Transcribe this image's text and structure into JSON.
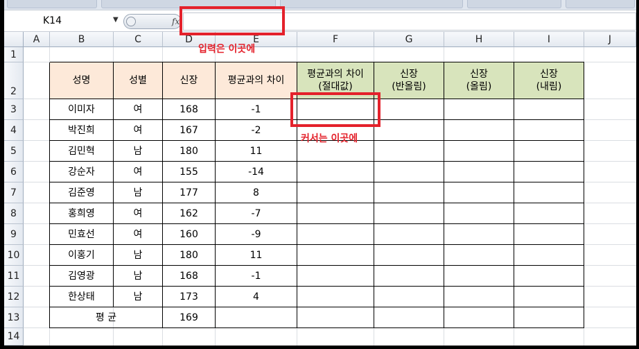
{
  "formula_bar": {
    "name_box": "K14",
    "fx_label": "fx",
    "formula_value": ""
  },
  "columns": [
    "A",
    "B",
    "C",
    "D",
    "E",
    "F",
    "G",
    "H",
    "I",
    "J"
  ],
  "rows": [
    "1",
    "2",
    "3",
    "4",
    "5",
    "6",
    "7",
    "8",
    "9",
    "10",
    "11",
    "12",
    "13",
    "14"
  ],
  "table": {
    "headers": [
      "성명",
      "성별",
      "신장",
      "평균과의 차이",
      "평균과의 차이\n(절대값)",
      "신장\n(반올림)",
      "신장\n(올림)",
      "신장\n(내림)"
    ],
    "rows": [
      [
        "이미자",
        "여",
        "168",
        "-1",
        "",
        "",
        "",
        ""
      ],
      [
        "박진희",
        "여",
        "167",
        "-2",
        "",
        "",
        "",
        ""
      ],
      [
        "김민혁",
        "남",
        "180",
        "11",
        "",
        "",
        "",
        ""
      ],
      [
        "강순자",
        "여",
        "155",
        "-14",
        "",
        "",
        "",
        ""
      ],
      [
        "김준영",
        "남",
        "177",
        "8",
        "",
        "",
        "",
        ""
      ],
      [
        "홍희영",
        "여",
        "162",
        "-7",
        "",
        "",
        "",
        ""
      ],
      [
        "민효선",
        "여",
        "160",
        "-9",
        "",
        "",
        "",
        ""
      ],
      [
        "이홍기",
        "남",
        "180",
        "11",
        "",
        "",
        "",
        ""
      ],
      [
        "김영광",
        "남",
        "168",
        "-1",
        "",
        "",
        "",
        ""
      ],
      [
        "한상태",
        "남",
        "173",
        "4",
        "",
        "",
        "",
        ""
      ]
    ],
    "average_label": "평 균",
    "average_value": "169"
  },
  "annotations": {
    "input_here": "입력은 이곳에",
    "cursor_here": "커서는 이곳에"
  },
  "colors": {
    "header_peach": "#fde9d9",
    "header_green": "#d8e4bc",
    "annotation_red": "#e4212b"
  }
}
